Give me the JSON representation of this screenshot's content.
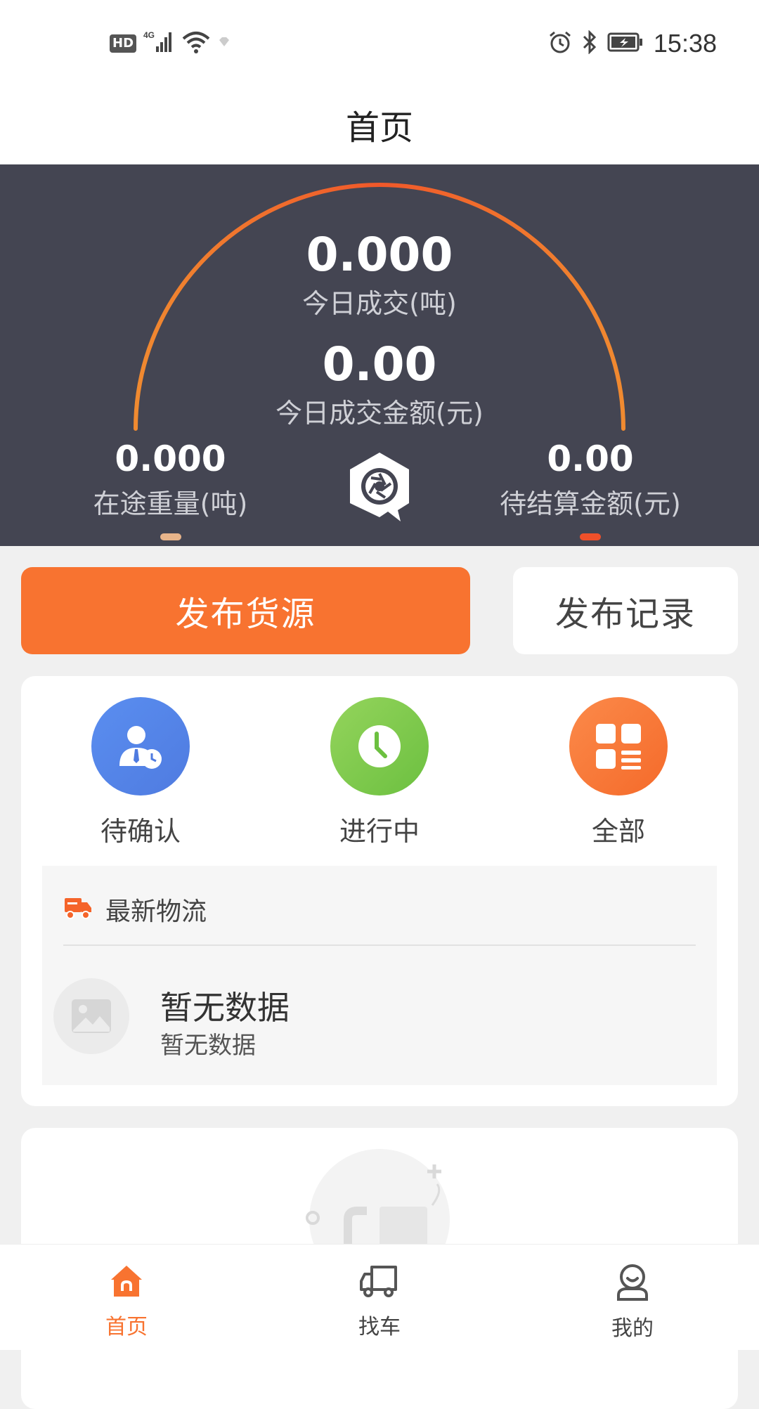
{
  "status_bar": {
    "hd": "HD",
    "network": "4G",
    "time": "15:38"
  },
  "header": {
    "title": "首页"
  },
  "dashboard": {
    "today_volume_value": "0.000",
    "today_volume_label": "今日成交(吨)",
    "today_amount_value": "0.00",
    "today_amount_label": "今日成交金额(元)",
    "in_transit_value": "0.000",
    "in_transit_label": "在途重量(吨)",
    "pending_value": "0.00",
    "pending_label": "待结算金额(元)",
    "arc_color_start": "#f07a2a",
    "arc_color_end": "#f0582a",
    "dot_left_color": "#e8b48a",
    "dot_right_color": "#f0502a"
  },
  "actions": {
    "publish_label": "发布货源",
    "record_label": "发布记录",
    "accent": "#f87330"
  },
  "shortcuts": [
    {
      "label": "待确认",
      "icon": "pending-user-icon"
    },
    {
      "label": "进行中",
      "icon": "clock-icon"
    },
    {
      "label": "全部",
      "icon": "grid-list-icon"
    }
  ],
  "logistics": {
    "title": "最新物流",
    "empty_title": "暂无数据",
    "empty_subtitle": "暂无数据"
  },
  "bottom_nav": [
    {
      "label": "首页",
      "icon": "home-icon",
      "active": true
    },
    {
      "label": "找车",
      "icon": "truck-icon",
      "active": false
    },
    {
      "label": "我的",
      "icon": "profile-icon",
      "active": false
    }
  ]
}
